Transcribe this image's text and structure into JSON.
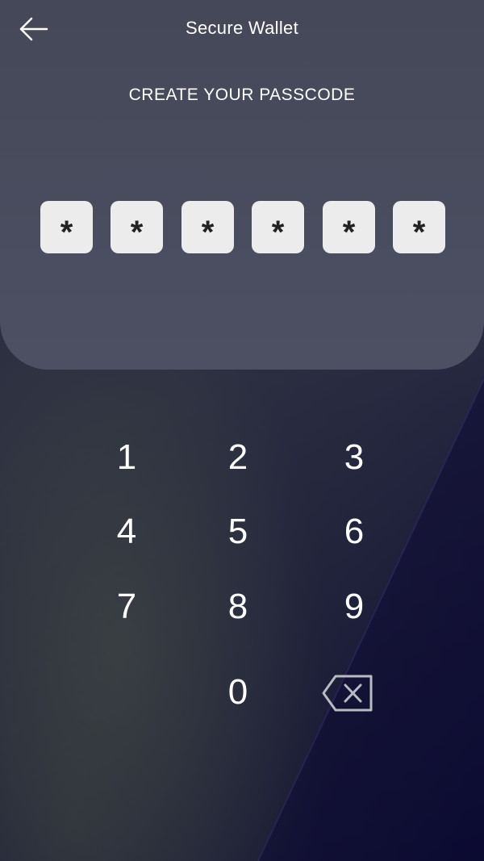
{
  "header": {
    "title": "Secure Wallet",
    "back_icon": "arrow-left-icon"
  },
  "passcode": {
    "heading": "CREATE YOUR PASSCODE",
    "digits": [
      "*",
      "*",
      "*",
      "*",
      "*",
      "*"
    ]
  },
  "keypad": {
    "keys": [
      "1",
      "2",
      "3",
      "4",
      "5",
      "6",
      "7",
      "8",
      "9",
      "0"
    ],
    "delete_icon": "backspace-icon"
  },
  "colors": {
    "panel": "#4a4d60",
    "pin_box": "#ececec",
    "text": "#ffffff"
  }
}
